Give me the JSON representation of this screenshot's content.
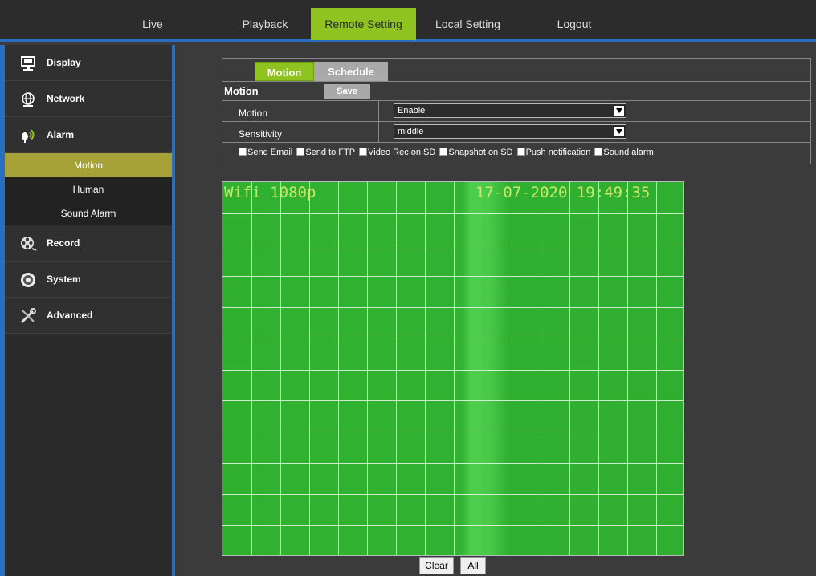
{
  "nav": {
    "live": "Live",
    "playback": "Playback",
    "remote_setting": "Remote Setting",
    "local_setting": "Local Setting",
    "logout": "Logout",
    "active_color": "#8fc31f"
  },
  "sidebar": {
    "display": "Display",
    "network": "Network",
    "alarm": "Alarm",
    "alarm_sub": [
      "Motion",
      "Human",
      "Sound Alarm"
    ],
    "record": "Record",
    "system": "System",
    "advanced": "Advanced",
    "accent": "#2a6fbf",
    "sub_active_color": "#a6a237"
  },
  "tabs": {
    "motion": "Motion",
    "schedule": "Schedule"
  },
  "form": {
    "title": "Motion",
    "save": "Save",
    "motion_label": "Motion",
    "motion_value": "Enable",
    "sensitivity_label": "Sensitivity",
    "sensitivity_value": "middle",
    "checks": [
      "Send Email",
      "Send to FTP",
      "Video Rec on SD",
      "Snapshot on SD",
      "Push notification",
      "Sound alarm"
    ]
  },
  "video": {
    "osd_left": "Wifi 1080p",
    "osd_right": "17-07-2020 19:49:35",
    "grid_color": "#ffffff"
  },
  "buttons": {
    "clear": "Clear",
    "all": "All"
  }
}
